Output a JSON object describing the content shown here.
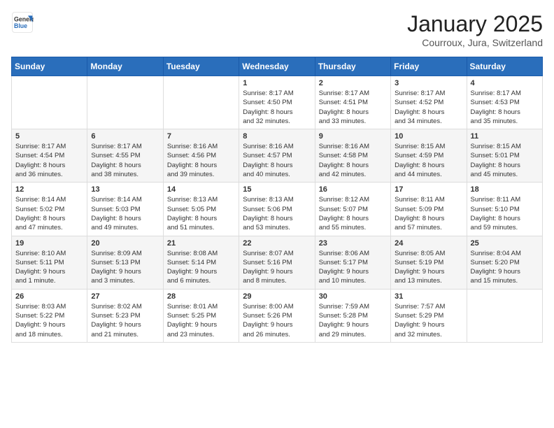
{
  "header": {
    "logo_general": "General",
    "logo_blue": "Blue",
    "month_title": "January 2025",
    "location": "Courroux, Jura, Switzerland"
  },
  "days_of_week": [
    "Sunday",
    "Monday",
    "Tuesday",
    "Wednesday",
    "Thursday",
    "Friday",
    "Saturday"
  ],
  "weeks": [
    [
      {
        "day": "",
        "info": ""
      },
      {
        "day": "",
        "info": ""
      },
      {
        "day": "",
        "info": ""
      },
      {
        "day": "1",
        "info": "Sunrise: 8:17 AM\nSunset: 4:50 PM\nDaylight: 8 hours\nand 32 minutes."
      },
      {
        "day": "2",
        "info": "Sunrise: 8:17 AM\nSunset: 4:51 PM\nDaylight: 8 hours\nand 33 minutes."
      },
      {
        "day": "3",
        "info": "Sunrise: 8:17 AM\nSunset: 4:52 PM\nDaylight: 8 hours\nand 34 minutes."
      },
      {
        "day": "4",
        "info": "Sunrise: 8:17 AM\nSunset: 4:53 PM\nDaylight: 8 hours\nand 35 minutes."
      }
    ],
    [
      {
        "day": "5",
        "info": "Sunrise: 8:17 AM\nSunset: 4:54 PM\nDaylight: 8 hours\nand 36 minutes."
      },
      {
        "day": "6",
        "info": "Sunrise: 8:17 AM\nSunset: 4:55 PM\nDaylight: 8 hours\nand 38 minutes."
      },
      {
        "day": "7",
        "info": "Sunrise: 8:16 AM\nSunset: 4:56 PM\nDaylight: 8 hours\nand 39 minutes."
      },
      {
        "day": "8",
        "info": "Sunrise: 8:16 AM\nSunset: 4:57 PM\nDaylight: 8 hours\nand 40 minutes."
      },
      {
        "day": "9",
        "info": "Sunrise: 8:16 AM\nSunset: 4:58 PM\nDaylight: 8 hours\nand 42 minutes."
      },
      {
        "day": "10",
        "info": "Sunrise: 8:15 AM\nSunset: 4:59 PM\nDaylight: 8 hours\nand 44 minutes."
      },
      {
        "day": "11",
        "info": "Sunrise: 8:15 AM\nSunset: 5:01 PM\nDaylight: 8 hours\nand 45 minutes."
      }
    ],
    [
      {
        "day": "12",
        "info": "Sunrise: 8:14 AM\nSunset: 5:02 PM\nDaylight: 8 hours\nand 47 minutes."
      },
      {
        "day": "13",
        "info": "Sunrise: 8:14 AM\nSunset: 5:03 PM\nDaylight: 8 hours\nand 49 minutes."
      },
      {
        "day": "14",
        "info": "Sunrise: 8:13 AM\nSunset: 5:05 PM\nDaylight: 8 hours\nand 51 minutes."
      },
      {
        "day": "15",
        "info": "Sunrise: 8:13 AM\nSunset: 5:06 PM\nDaylight: 8 hours\nand 53 minutes."
      },
      {
        "day": "16",
        "info": "Sunrise: 8:12 AM\nSunset: 5:07 PM\nDaylight: 8 hours\nand 55 minutes."
      },
      {
        "day": "17",
        "info": "Sunrise: 8:11 AM\nSunset: 5:09 PM\nDaylight: 8 hours\nand 57 minutes."
      },
      {
        "day": "18",
        "info": "Sunrise: 8:11 AM\nSunset: 5:10 PM\nDaylight: 8 hours\nand 59 minutes."
      }
    ],
    [
      {
        "day": "19",
        "info": "Sunrise: 8:10 AM\nSunset: 5:11 PM\nDaylight: 9 hours\nand 1 minute."
      },
      {
        "day": "20",
        "info": "Sunrise: 8:09 AM\nSunset: 5:13 PM\nDaylight: 9 hours\nand 3 minutes."
      },
      {
        "day": "21",
        "info": "Sunrise: 8:08 AM\nSunset: 5:14 PM\nDaylight: 9 hours\nand 6 minutes."
      },
      {
        "day": "22",
        "info": "Sunrise: 8:07 AM\nSunset: 5:16 PM\nDaylight: 9 hours\nand 8 minutes."
      },
      {
        "day": "23",
        "info": "Sunrise: 8:06 AM\nSunset: 5:17 PM\nDaylight: 9 hours\nand 10 minutes."
      },
      {
        "day": "24",
        "info": "Sunrise: 8:05 AM\nSunset: 5:19 PM\nDaylight: 9 hours\nand 13 minutes."
      },
      {
        "day": "25",
        "info": "Sunrise: 8:04 AM\nSunset: 5:20 PM\nDaylight: 9 hours\nand 15 minutes."
      }
    ],
    [
      {
        "day": "26",
        "info": "Sunrise: 8:03 AM\nSunset: 5:22 PM\nDaylight: 9 hours\nand 18 minutes."
      },
      {
        "day": "27",
        "info": "Sunrise: 8:02 AM\nSunset: 5:23 PM\nDaylight: 9 hours\nand 21 minutes."
      },
      {
        "day": "28",
        "info": "Sunrise: 8:01 AM\nSunset: 5:25 PM\nDaylight: 9 hours\nand 23 minutes."
      },
      {
        "day": "29",
        "info": "Sunrise: 8:00 AM\nSunset: 5:26 PM\nDaylight: 9 hours\nand 26 minutes."
      },
      {
        "day": "30",
        "info": "Sunrise: 7:59 AM\nSunset: 5:28 PM\nDaylight: 9 hours\nand 29 minutes."
      },
      {
        "day": "31",
        "info": "Sunrise: 7:57 AM\nSunset: 5:29 PM\nDaylight: 9 hours\nand 32 minutes."
      },
      {
        "day": "",
        "info": ""
      }
    ]
  ]
}
